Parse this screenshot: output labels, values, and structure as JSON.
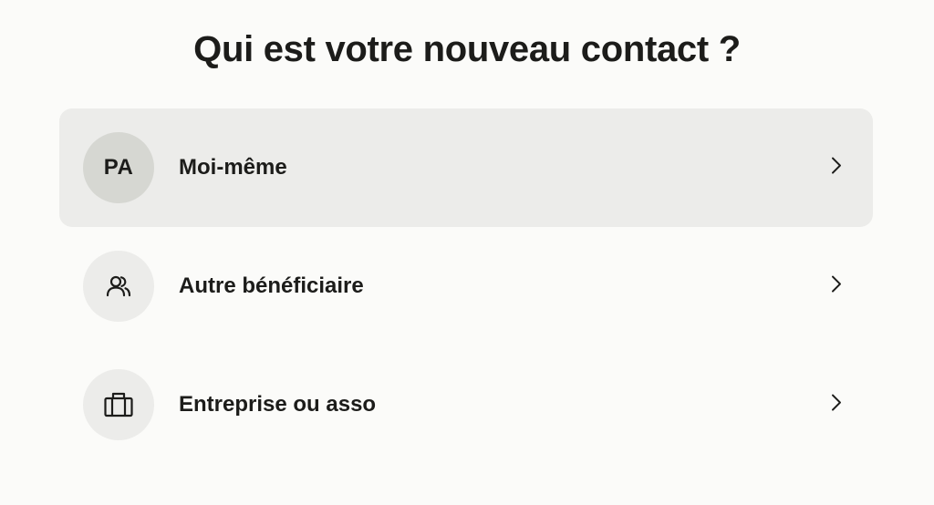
{
  "page": {
    "title": "Qui est votre nouveau contact ?"
  },
  "options": [
    {
      "label": "Moi-même",
      "avatar_type": "initials",
      "initials": "PA",
      "selected": true
    },
    {
      "label": "Autre bénéficiaire",
      "avatar_type": "icon",
      "icon": "users-icon",
      "selected": false
    },
    {
      "label": "Entreprise ou asso",
      "avatar_type": "icon",
      "icon": "briefcase-icon",
      "selected": false
    }
  ],
  "colors": {
    "background": "#fbfbf9",
    "selected_row": "#ececea",
    "avatar_circle": "#ececea",
    "selected_avatar_circle": "#d6d7d2",
    "text": "#1c1c1a"
  }
}
